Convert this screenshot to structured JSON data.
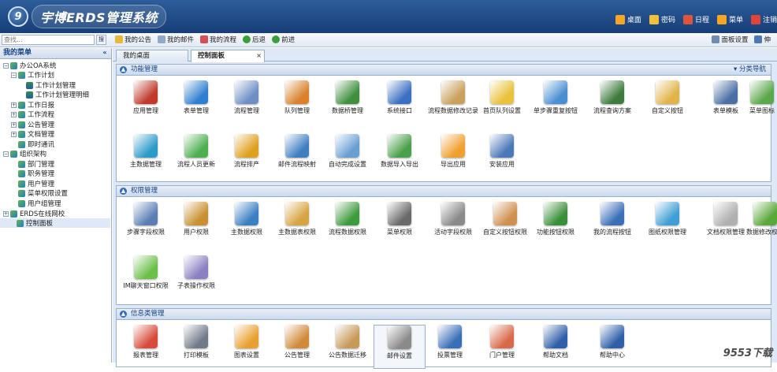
{
  "header": {
    "logo_mark": "9",
    "title": "宇博ERDS管理系统",
    "nav": [
      {
        "label": "桌面",
        "icon": "home-icon",
        "color": "#f5a623"
      },
      {
        "label": "密码",
        "icon": "lock-icon",
        "color": "#f0c03c"
      },
      {
        "label": "日程",
        "icon": "calendar-icon",
        "color": "#e0543c"
      },
      {
        "label": "菜单",
        "icon": "menu-icon",
        "color": "#f5a623"
      },
      {
        "label": "注销",
        "icon": "power-icon",
        "color": "#e0453a"
      }
    ]
  },
  "toolbar": {
    "search_placeholder": "查找...",
    "search_button": "搜",
    "items": [
      {
        "label": "我的公告",
        "icon": "announce-icon",
        "color": "#e8b83a"
      },
      {
        "label": "我的邮件",
        "icon": "mail-icon",
        "color": "#8ea9c9"
      },
      {
        "label": "我的流程",
        "icon": "flow-icon",
        "color": "#d45151"
      },
      {
        "label": "后退",
        "icon": "back-icon",
        "color": "#3a9d3a"
      },
      {
        "label": "前进",
        "icon": "forward-icon",
        "color": "#3a9d3a"
      }
    ],
    "right_items": [
      {
        "label": "面板设置",
        "icon": "panel-settings-icon",
        "color": "#6f8bb0"
      },
      {
        "label": "伸",
        "icon": "expand-icon",
        "color": "#4a78b8"
      }
    ]
  },
  "sidebar": {
    "title": "我的菜单",
    "collapse": "«",
    "items": [
      {
        "label": "办公OA系统",
        "exp": "-",
        "icon": "folder"
      },
      {
        "label": "工作计划",
        "exp": "-",
        "icon": "folder"
      },
      {
        "label": "工作计划管理",
        "exp": "",
        "icon": "doc"
      },
      {
        "label": "工作计划管理明细",
        "exp": "",
        "icon": "doc"
      },
      {
        "label": "工作日报",
        "exp": "+",
        "icon": "folder"
      },
      {
        "label": "工作流程",
        "exp": "+",
        "icon": "folder"
      },
      {
        "label": "公告管理",
        "exp": "+",
        "icon": "folder"
      },
      {
        "label": "文档管理",
        "exp": "+",
        "icon": "folder"
      },
      {
        "label": "即时通讯",
        "exp": "",
        "icon": "folder"
      },
      {
        "label": "组织架构",
        "exp": "-",
        "icon": "folder"
      },
      {
        "label": "部门管理",
        "exp": "",
        "icon": "folder"
      },
      {
        "label": "职务管理",
        "exp": "",
        "icon": "folder"
      },
      {
        "label": "用户管理",
        "exp": "",
        "icon": "folder"
      },
      {
        "label": "菜单权限设置",
        "exp": "",
        "icon": "folder"
      },
      {
        "label": "用户组管理",
        "exp": "",
        "icon": "folder"
      },
      {
        "label": "ERDS在线网校",
        "exp": "+",
        "icon": "folder"
      },
      {
        "label": "控制面板",
        "exp": "",
        "icon": "folder",
        "selected": true
      }
    ]
  },
  "tabs": [
    {
      "label": "我的桌面"
    },
    {
      "label": "控制面板",
      "close": "×"
    }
  ],
  "panels": [
    {
      "title": "功能管理",
      "toggle": "▲",
      "side_link": "▾ 分类导航",
      "apps": [
        {
          "label": "应用管理",
          "icon": "app-manage-icon",
          "color": "#c0392b"
        },
        {
          "label": "表单管理",
          "icon": "form-manage-icon",
          "color": "#2f7fd0"
        },
        {
          "label": "流程管理",
          "icon": "flow-manage-icon",
          "color": "#6d8fc4"
        },
        {
          "label": "队列管理",
          "icon": "queue-manage-icon",
          "color": "#d9822b"
        },
        {
          "label": "数据桥管理",
          "icon": "data-bridge-icon",
          "color": "#3f8f3f"
        },
        {
          "label": "系统接口",
          "icon": "usb-icon",
          "color": "#3a6fc2"
        },
        {
          "label": "流程数据修改记录",
          "icon": "flow-edit-record-icon",
          "color": "#c9a15a"
        },
        {
          "label": "首页队列设置",
          "icon": "home-queue-icon",
          "color": "#e8c23a"
        },
        {
          "label": "单步骤重复按钮",
          "icon": "step-repeat-icon",
          "color": "#4a8fd1"
        },
        {
          "label": "流程查询方案",
          "icon": "flow-query-icon",
          "color": "#3d7a3d"
        },
        {
          "label": "自定义按钮",
          "icon": "custom-button-icon",
          "color": "#e0b44a"
        },
        {
          "label": "表单模板",
          "icon": "monitor-icon",
          "color": "#4a6fa5"
        },
        {
          "label": "菜单图标",
          "icon": "menu-icon-icon",
          "color": "#5aa84a"
        },
        {
          "label": "主数据管理",
          "icon": "master-data-icon",
          "color": "#2d9bc9"
        },
        {
          "label": "流程人员更新",
          "icon": "recycle-icon",
          "color": "#4caf50"
        },
        {
          "label": "流程排产",
          "icon": "gear-icon",
          "color": "#e0a020"
        },
        {
          "label": "邮件流程映射",
          "icon": "mail-flow-icon",
          "color": "#3f7fc0"
        },
        {
          "label": "自动完成设置",
          "icon": "magnifier-icon",
          "color": "#6a9fd4"
        },
        {
          "label": "数据导入导出",
          "icon": "import-export-icon",
          "color": "#4aa04a"
        },
        {
          "label": "导出应用",
          "icon": "export-app-icon",
          "color": "#f0a030"
        },
        {
          "label": "安装应用",
          "icon": "install-app-icon",
          "color": "#4a78b8"
        }
      ]
    },
    {
      "title": "权限管理",
      "toggle": "▲",
      "side_link": "",
      "apps": [
        {
          "label": "步骤字段权限",
          "icon": "step-field-icon",
          "color": "#5b7fb5"
        },
        {
          "label": "用户权限",
          "icon": "user-lock-icon",
          "color": "#c89030"
        },
        {
          "label": "主数据权限",
          "icon": "master-lock-icon",
          "color": "#3a7fc2"
        },
        {
          "label": "主数据表权限",
          "icon": "master-table-lock-icon",
          "color": "#d6a440"
        },
        {
          "label": "流程数据权限",
          "icon": "flow-data-lock-icon",
          "color": "#3d9b3d"
        },
        {
          "label": "菜单权限",
          "icon": "menu-lock-icon",
          "color": "#6a6a6a"
        },
        {
          "label": "活动字段权限",
          "icon": "activity-field-icon",
          "color": "#8a8a8a"
        },
        {
          "label": "自定义按钮权限",
          "icon": "custom-button-lock-icon",
          "color": "#d09050"
        },
        {
          "label": "功能按钮权限",
          "icon": "function-button-lock-icon",
          "color": "#3a8f3a"
        },
        {
          "label": "我的流程按钮",
          "icon": "my-flow-button-icon",
          "color": "#3a6fb8"
        },
        {
          "label": "图纸权限管理",
          "icon": "drawing-lock-icon",
          "color": "#3f9fd4"
        },
        {
          "label": "文档权限管理",
          "icon": "doc-lock-icon",
          "color": "#b0b0b0"
        },
        {
          "label": "数据修改权限",
          "icon": "data-edit-lock-icon",
          "color": "#5aa83a"
        },
        {
          "label": "IM聊天窗口权限",
          "icon": "chat-icon",
          "color": "#6cc04a"
        },
        {
          "label": "子表操作权限",
          "icon": "subtable-pen-icon",
          "color": "#8a7fc0"
        }
      ]
    },
    {
      "title": "信息类管理",
      "toggle": "▲",
      "side_link": "",
      "apps": [
        {
          "label": "报表管理",
          "icon": "report-icon",
          "color": "#d84a3a"
        },
        {
          "label": "打印模板",
          "icon": "printer-icon",
          "color": "#707a88"
        },
        {
          "label": "图表设置",
          "icon": "chart-settings-icon",
          "color": "#e8a030"
        },
        {
          "label": "公告管理",
          "icon": "announce-user-icon",
          "color": "#d08a3a"
        },
        {
          "label": "公告数据迁移",
          "icon": "clipboard-icon",
          "color": "#c79a5a"
        },
        {
          "label": "邮件设置",
          "icon": "mail-settings-icon",
          "color": "#8a8a8a",
          "selected": true
        },
        {
          "label": "投票管理",
          "icon": "vote-icon",
          "color": "#3a6fb8"
        },
        {
          "label": "门户管理",
          "icon": "portal-icon",
          "color": "#d86a4a"
        },
        {
          "label": "帮助文档",
          "icon": "help-doc-icon",
          "color": "#2f5fa8"
        },
        {
          "label": "帮助中心",
          "icon": "help-center-icon",
          "color": "#2f5fa8"
        }
      ]
    }
  ],
  "watermark": {
    "main": "9553",
    "suffix": "下载"
  }
}
